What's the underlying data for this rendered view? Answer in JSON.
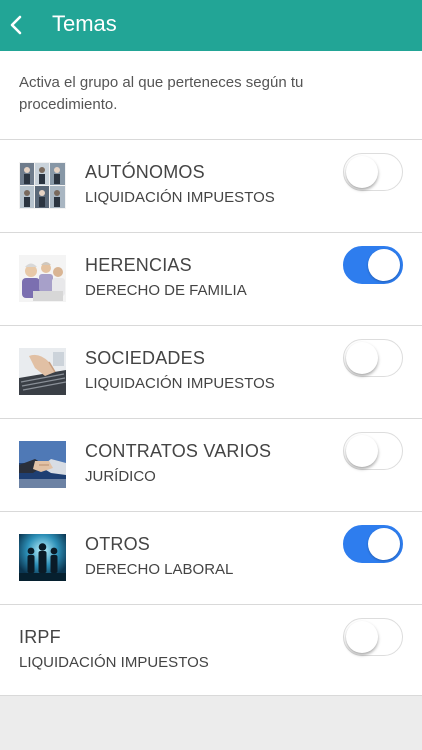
{
  "header": {
    "title": "Temas",
    "back_icon": "chevron-left-icon",
    "bar_color": "#22a596"
  },
  "intro_text": "Activa el grupo al que perteneces según tu procedimiento.",
  "toggle_on_color": "#2e7dee",
  "items": [
    {
      "title": "AUTÓNOMOS",
      "subtitle": "LIQUIDACIÓN IMPUESTOS",
      "enabled": false,
      "image": "business-people-collage-thumbnail"
    },
    {
      "title": "HERENCIAS",
      "subtitle": "DERECHO DE FAMILIA",
      "enabled": true,
      "image": "family-meeting-thumbnail"
    },
    {
      "title": "SOCIEDADES",
      "subtitle": "LIQUIDACIÓN IMPUESTOS",
      "enabled": false,
      "image": "keyboard-typing-thumbnail"
    },
    {
      "title": "CONTRATOS VARIOS",
      "subtitle": "JURÍDICO",
      "enabled": false,
      "image": "handshake-thumbnail"
    },
    {
      "title": "OTROS",
      "subtitle": "DERECHO LABORAL",
      "enabled": true,
      "image": "business-team-silhouettes-thumbnail"
    },
    {
      "title": "IRPF",
      "subtitle": "LIQUIDACIÓN IMPUESTOS",
      "enabled": false,
      "image": null
    }
  ]
}
